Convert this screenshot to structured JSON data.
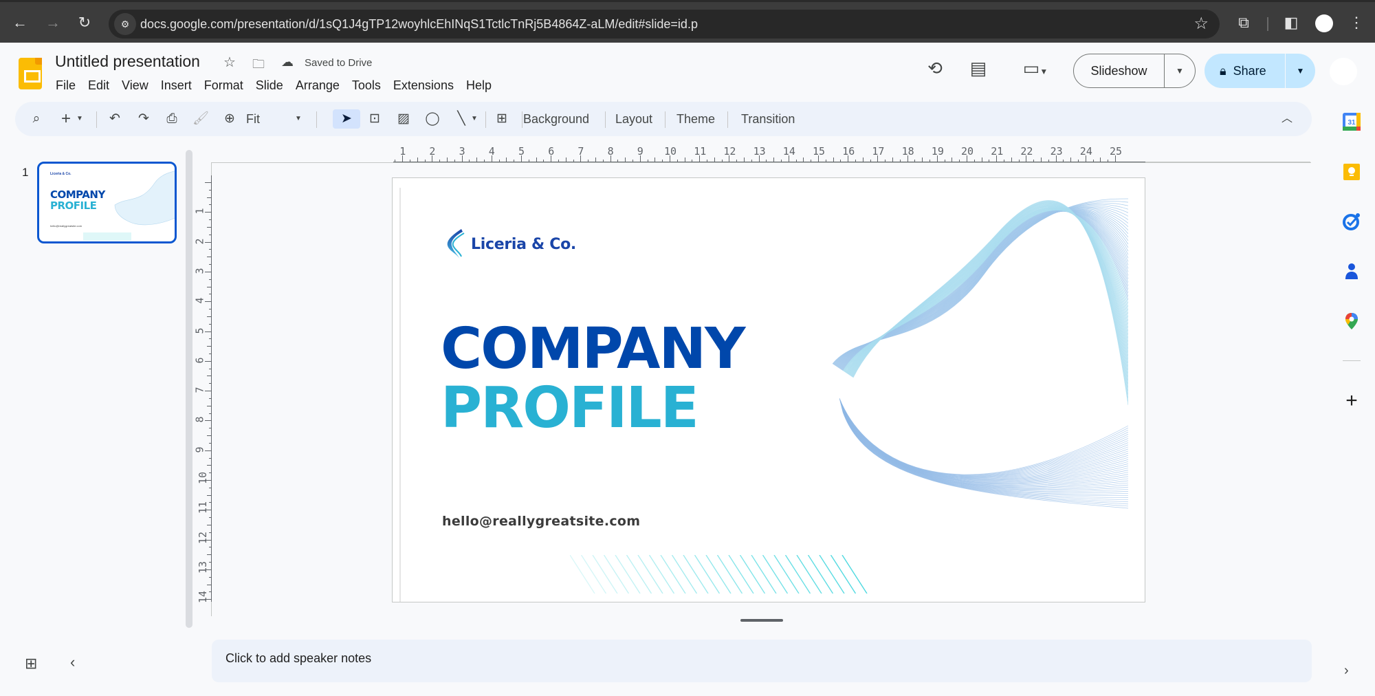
{
  "browser": {
    "url": "docs.google.com/presentation/d/1sQ1J4gTP12woyhlcEhINqS1TctlcTnRj5B4864Z-aLM/edit#slide=id.p",
    "back_icon": "arrow-left",
    "forward_icon": "arrow-right",
    "reload_icon": "reload",
    "bookmark_icon": "star",
    "extensions_icon": "puzzle",
    "sidepanel_icon": "side-panel",
    "menu_icon": "more-vert"
  },
  "header": {
    "title": "Untitled presentation",
    "saved_status": "Saved to Drive",
    "menu": [
      "File",
      "Edit",
      "View",
      "Insert",
      "Format",
      "Slide",
      "Arrange",
      "Tools",
      "Extensions",
      "Help"
    ],
    "slideshow_label": "Slideshow",
    "share_label": "Share"
  },
  "toolbar": {
    "zoom_value": "Fit",
    "background_label": "Background",
    "layout_label": "Layout",
    "theme_label": "Theme",
    "transition_label": "Transition"
  },
  "filmstrip": {
    "slides": [
      {
        "number": "1",
        "logo": "Liceria & Co.",
        "title1": "COMPANY",
        "title2": "PROFILE",
        "email": "hello@reallygreatsite.com"
      }
    ]
  },
  "rulers": {
    "horizontal": [
      "1",
      "2",
      "3",
      "4",
      "5",
      "6",
      "7",
      "8",
      "9",
      "10",
      "11",
      "12",
      "13",
      "14",
      "15",
      "16",
      "17",
      "18",
      "19",
      "20",
      "21",
      "22",
      "23",
      "24",
      "25"
    ],
    "vertical": [
      "1",
      "2",
      "3",
      "4",
      "5",
      "6",
      "7",
      "8",
      "9",
      "10",
      "11",
      "12",
      "13",
      "14"
    ]
  },
  "slide": {
    "brand_name": "Liceria & Co.",
    "title_line1": "COMPANY",
    "title_line2": "PROFILE",
    "email": "hello@reallygreatsite.com",
    "colors": {
      "primary": "#0047ab",
      "secondary": "#29b1d3",
      "accent_stripes": "#4dd9e0"
    }
  },
  "notes": {
    "placeholder": "Click to add speaker notes"
  },
  "side_panel": {
    "apps": [
      "Calendar",
      "Keep",
      "Tasks",
      "Contacts",
      "Maps"
    ]
  }
}
